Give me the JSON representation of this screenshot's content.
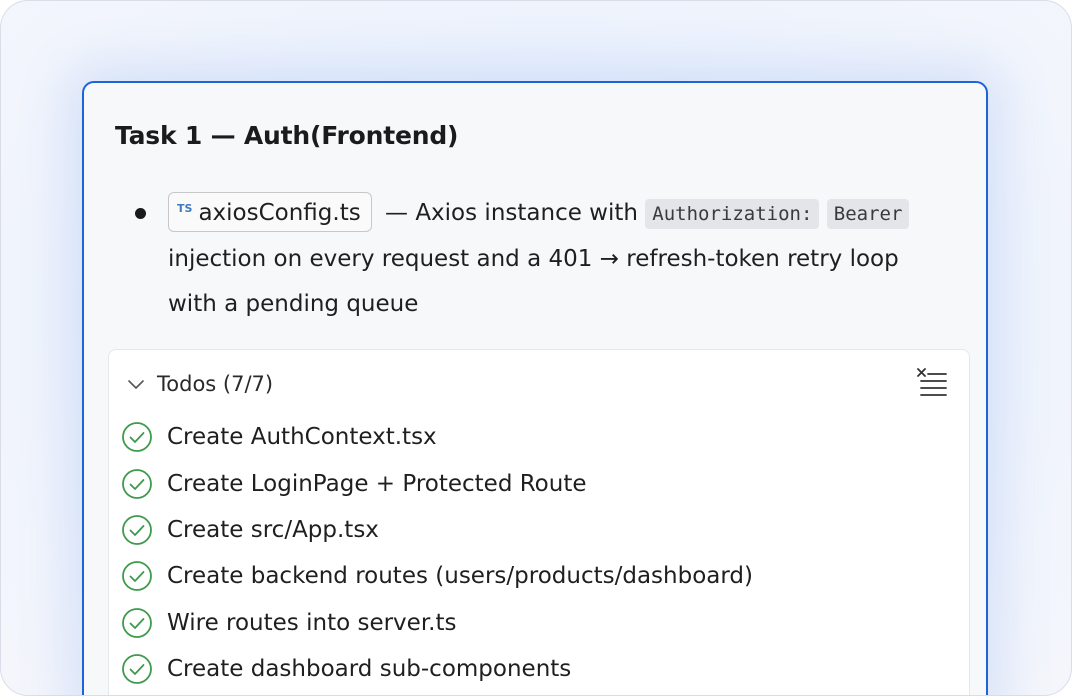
{
  "task": {
    "title": "Task 1 — Auth(Frontend)"
  },
  "bullet": {
    "file_badge": "TS",
    "file_name": "axiosConfig.ts",
    "text_1": " — Axios instance with ",
    "code_1": "Authorization:",
    "code_2": "Bearer",
    "text_2": " injection on every request and a 401 → refresh-token retry loop with a pending queue"
  },
  "todos": {
    "title": "Todos (7/7)",
    "icons": {
      "toggle": "chevron-down-icon",
      "clear": "clear-list-icon",
      "item": "check-circle-icon"
    },
    "colors": {
      "check": "#3e9a4c",
      "accent_border": "#1f63d8"
    },
    "items": [
      {
        "label": "Create AuthContext.tsx",
        "done": true
      },
      {
        "label": "Create LoginPage + Protected Route",
        "done": true
      },
      {
        "label": "Create src/App.tsx",
        "done": true
      },
      {
        "label": "Create backend routes (users/products/dashboard)",
        "done": true
      },
      {
        "label": "Wire routes into server.ts",
        "done": true
      },
      {
        "label": "Create dashboard sub-components",
        "done": true
      }
    ]
  }
}
